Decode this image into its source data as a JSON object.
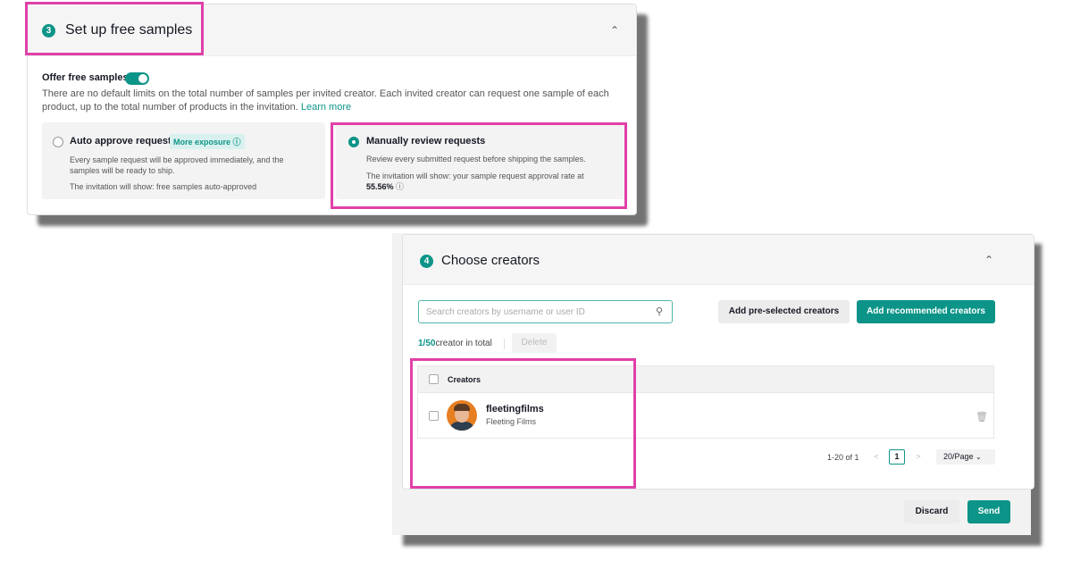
{
  "colors": {
    "accent": "#0d9488",
    "highlight": "#e040a8"
  },
  "samples_section": {
    "step": "3",
    "title": "Set up free samples",
    "collapse_icon": "chevron-up-icon",
    "offer_label": "Offer free samples",
    "offer_enabled": true,
    "description": "There are no default limits on the total number of samples per invited creator. Each invited creator can request one sample of each product, up to the total number of products in the invitation.",
    "learn_more": "Learn more",
    "options": [
      {
        "title": "Auto approve requests",
        "tag": "More exposure",
        "selected": false,
        "text1": "Every sample request will be approved immediately, and the samples will be ready to ship.",
        "text2": "The invitation will show: free samples auto-approved"
      },
      {
        "title": "Manually review requests",
        "selected": true,
        "text1": "Review every submitted request before shipping the samples.",
        "text2": "The invitation will show: your sample request approval rate at",
        "rate": "55.56%"
      }
    ]
  },
  "creators_section": {
    "step": "4",
    "title": "Choose creators",
    "collapse_icon": "chevron-up-icon",
    "search_placeholder": "Search creators by username or user ID",
    "add_preselected": "Add pre-selected creators",
    "add_recommended": "Add recommended creators",
    "count_value": "1/50",
    "count_text": "creator in total",
    "delete_label": "Delete",
    "table_header": "Creators",
    "rows": [
      {
        "name": "fleetingfilms",
        "display_name": "Fleeting Films"
      }
    ],
    "pagination": {
      "range": "1-20 of 1",
      "current_page": "1",
      "page_size": "20/Page"
    }
  },
  "footer": {
    "discard": "Discard",
    "send": "Send"
  }
}
